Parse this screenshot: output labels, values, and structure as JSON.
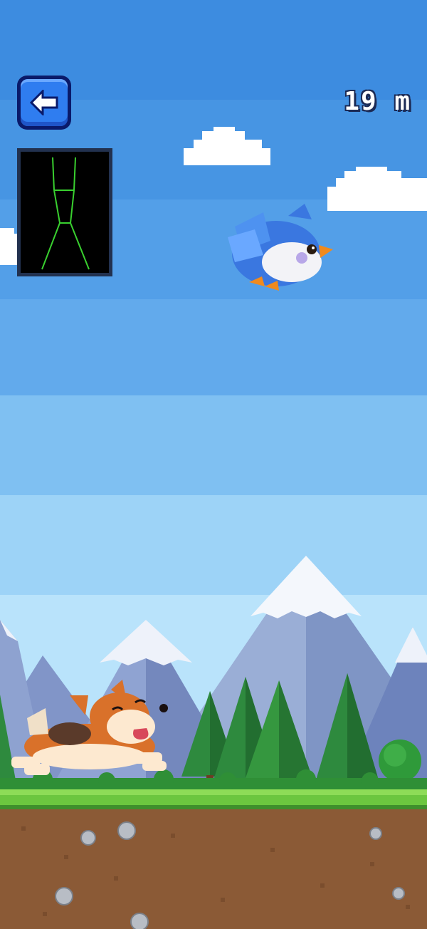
{
  "hud": {
    "distance_value": "19",
    "distance_unit": "m",
    "back_icon": "arrow-left-icon"
  },
  "pose_overlay": {
    "icon": "skeleton-pose-icon",
    "line_color": "#39d02f"
  },
  "colors": {
    "sky_top": "#3d8ce0",
    "sky_bottom": "#b9e3fb",
    "grass": "#6cc63f",
    "soil": "#8b5a36",
    "button_blue": "#2f7df0"
  },
  "sprites": {
    "bird": "blue-bird-sprite",
    "dog": "corgi-sprite"
  }
}
